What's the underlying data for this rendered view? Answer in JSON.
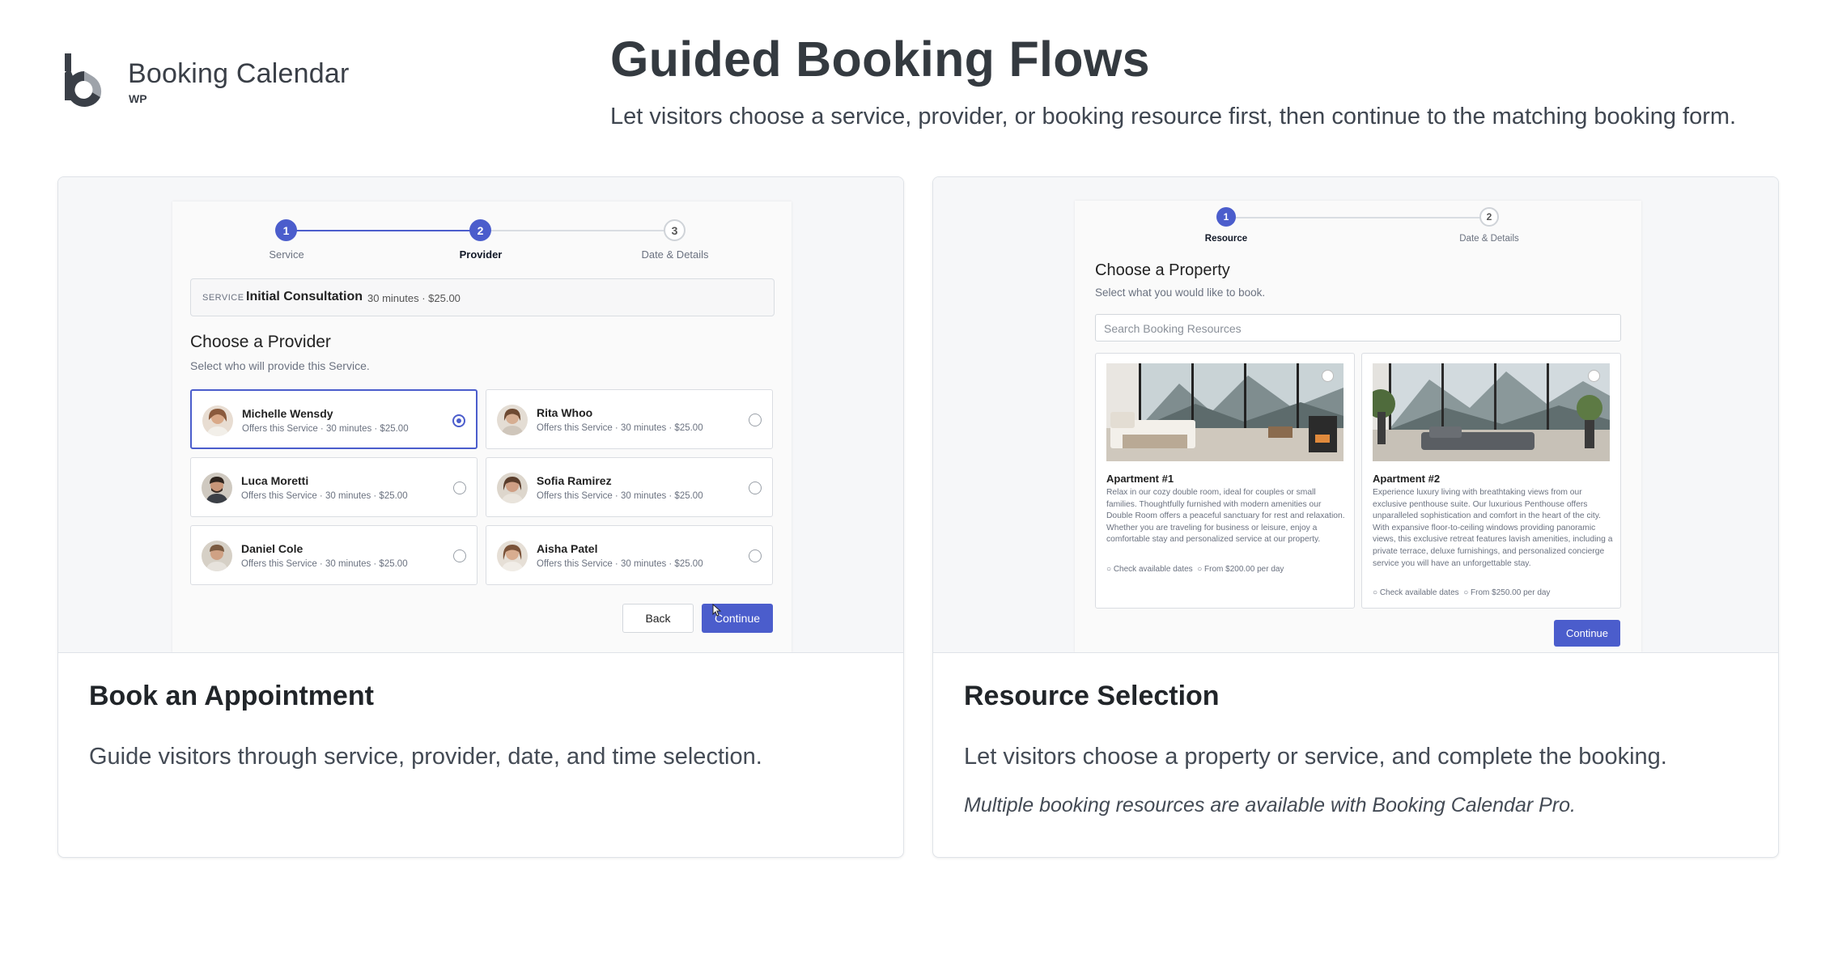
{
  "brand": {
    "name": "Booking Calendar",
    "sub": "WP"
  },
  "header": {
    "title": "Guided Booking Flows",
    "subtitle": "Let visitors choose a service, provider, or booking resource first, then continue to the matching booking form."
  },
  "cards": [
    {
      "title": "Book an Appointment",
      "description": "Guide visitors through service, provider, date, and time selection.",
      "preview": {
        "steps": [
          {
            "num": "1",
            "label": "Service"
          },
          {
            "num": "2",
            "label": "Provider"
          },
          {
            "num": "3",
            "label": "Date & Details"
          }
        ],
        "service": {
          "tag": "SERVICE",
          "name": "Initial Consultation",
          "meta": "30 minutes · $25.00"
        },
        "heading": "Choose a Provider",
        "subheading": "Select who will provide this Service.",
        "providers": [
          {
            "name": "Michelle Wensdy",
            "meta": "Offers this Service · 30 minutes · $25.00",
            "selected": true
          },
          {
            "name": "Rita Whoo",
            "meta": "Offers this Service · 30 minutes · $25.00",
            "selected": false
          },
          {
            "name": "Luca Moretti",
            "meta": "Offers this Service · 30 minutes · $25.00",
            "selected": false
          },
          {
            "name": "Sofia Ramirez",
            "meta": "Offers this Service · 30 minutes · $25.00",
            "selected": false
          },
          {
            "name": "Daniel Cole",
            "meta": "Offers this Service · 30 minutes · $25.00",
            "selected": false
          },
          {
            "name": "Aisha Patel",
            "meta": "Offers this Service · 30 minutes · $25.00",
            "selected": false
          }
        ],
        "back_label": "Back",
        "continue_label": "Continue"
      }
    },
    {
      "title": "Resource Selection",
      "description": "Let visitors choose a property or service, and complete the booking.",
      "note": "Multiple booking resources are available with Booking Calendar Pro.",
      "preview": {
        "steps": [
          {
            "num": "1",
            "label": "Resource"
          },
          {
            "num": "2",
            "label": "Date & Details"
          }
        ],
        "heading": "Choose a Property",
        "subheading": "Select what you would like to book.",
        "search_placeholder": "Search Booking Resources",
        "resources": [
          {
            "name": "Apartment #1",
            "description": "Relax in our cozy double room, ideal for couples or small families. Thoughtfully furnished with modern amenities our Double Room offers a peaceful sanctuary for rest and relaxation. Whether you are traveling for business or leisure, enjoy a comfortable stay and personalized service at our property.",
            "check": "Check available dates",
            "price": "From $200.00 per day"
          },
          {
            "name": "Apartment #2",
            "description": "Experience luxury living with breathtaking views from our exclusive penthouse suite. Our luxurious Penthouse offers unparalleled sophistication and comfort in the heart of the city. With expansive floor-to-ceiling windows providing panoramic views, this exclusive retreat features lavish amenities, including a private terrace, deluxe furnishings, and personalized concierge service you will have an unforgettable stay.",
            "check": "Check available dates",
            "price": "From $250.00 per day"
          }
        ],
        "continue_label": "Continue"
      }
    }
  ],
  "colors": {
    "accent": "#4b5dcc",
    "text": "#343a40",
    "border": "#dfe3e8"
  }
}
